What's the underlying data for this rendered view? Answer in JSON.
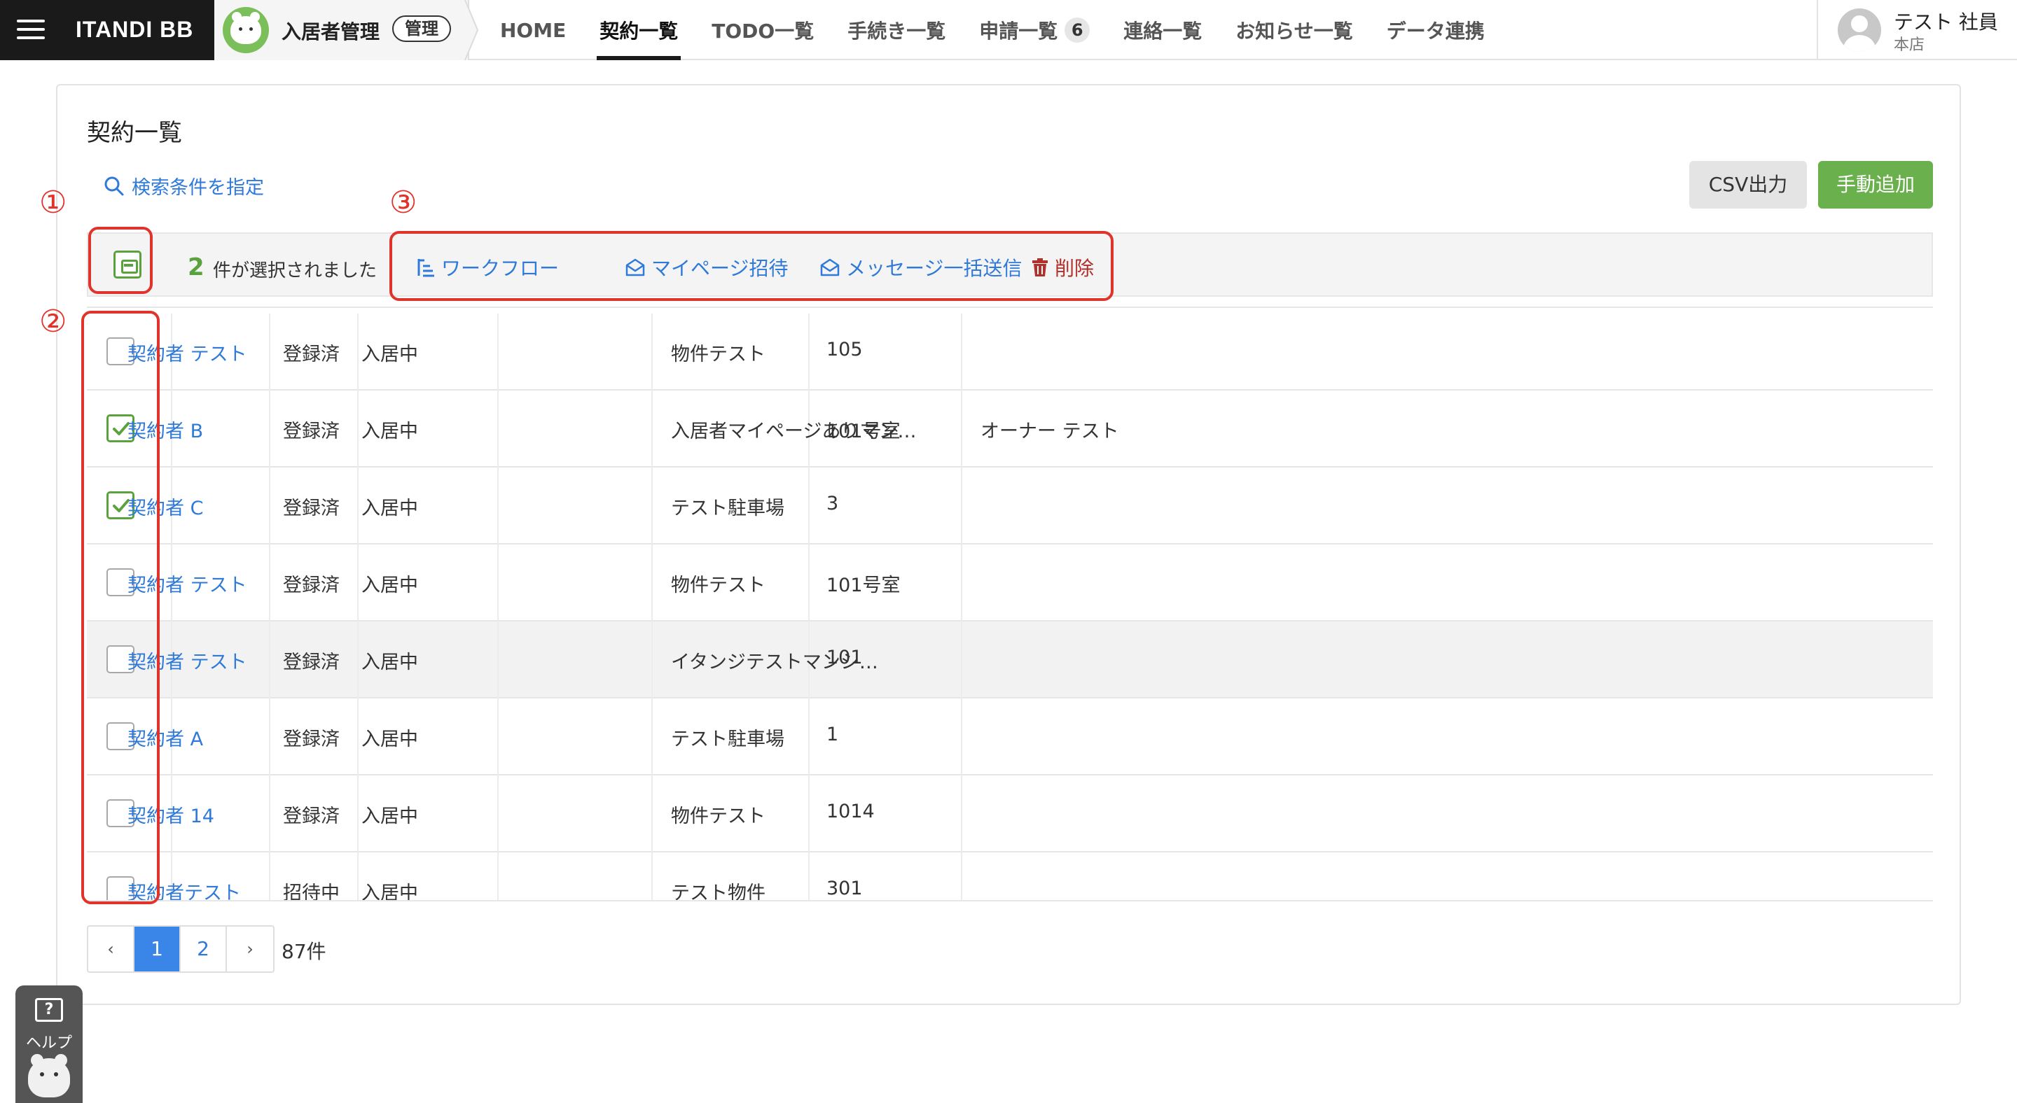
{
  "brand": {
    "name": "ITANDI BB"
  },
  "app": {
    "title": "入居者管理",
    "badge": "管理"
  },
  "nav": [
    {
      "label": "HOME",
      "count": ""
    },
    {
      "label": "契約一覧",
      "count": ""
    },
    {
      "label": "TODO一覧",
      "count": ""
    },
    {
      "label": "手続き一覧",
      "count": ""
    },
    {
      "label": "申請一覧",
      "count": "6"
    },
    {
      "label": "連絡一覧",
      "count": ""
    },
    {
      "label": "お知らせ一覧",
      "count": ""
    },
    {
      "label": "データ連携",
      "count": ""
    }
  ],
  "nav_active": "契約一覧",
  "user": {
    "name": "テスト 社員",
    "branch": "本店"
  },
  "page": {
    "title": "契約一覧",
    "search_link": "検索条件を指定",
    "csv_button": "CSV出力",
    "add_button": "手動追加"
  },
  "selection": {
    "count": "2",
    "text": "件が選択されました",
    "actions": {
      "workflow": "ワークフロー",
      "mypage_invite": "マイページ招待",
      "bulk_message": "メッセージ一括送信",
      "delete": "削除"
    }
  },
  "rows": [
    {
      "name": "契約者 テスト",
      "status": "登録済",
      "residency": "入居中",
      "property": "物件テスト",
      "room": "105",
      "owner": "",
      "checked": false
    },
    {
      "name": "契約者 B",
      "status": "登録済",
      "residency": "入居中",
      "property": "入居者マイページありマン…",
      "room": "101号室",
      "owner": "オーナー テスト",
      "checked": true
    },
    {
      "name": "契約者 C",
      "status": "登録済",
      "residency": "入居中",
      "property": "テスト駐車場",
      "room": "3",
      "owner": "",
      "checked": true
    },
    {
      "name": "契約者 テスト",
      "status": "登録済",
      "residency": "入居中",
      "property": "物件テスト",
      "room": "101号室",
      "owner": "",
      "checked": false
    },
    {
      "name": "契約者 テスト",
      "status": "登録済",
      "residency": "入居中",
      "property": "イタンジテストマンシ…",
      "room": "101",
      "owner": "",
      "checked": false
    },
    {
      "name": "契約者 A",
      "status": "登録済",
      "residency": "入居中",
      "property": "テスト駐車場",
      "room": "1",
      "owner": "",
      "checked": false
    },
    {
      "name": "契約者 14",
      "status": "登録済",
      "residency": "入居中",
      "property": "物件テスト",
      "room": "1014",
      "owner": "",
      "checked": false
    },
    {
      "name": "契約者テスト",
      "status": "招待中",
      "residency": "入居中",
      "property": "テスト物件",
      "room": "301",
      "owner": "",
      "checked": false
    }
  ],
  "pagination": {
    "prev": "‹",
    "pages": [
      "1",
      "2"
    ],
    "current": "1",
    "next": "›",
    "total": "87件"
  },
  "annotations": {
    "one": "①",
    "two": "②",
    "three": "③"
  },
  "help": {
    "label": "ヘルプ",
    "icon_text": "?"
  },
  "colors": {
    "accent_green": "#6ab04c",
    "link_blue": "#2f7ad8",
    "annotation_red": "#e0332b",
    "danger_red": "#b0302b"
  },
  "icons": {
    "menu": "hamburger-icon",
    "search": "search-icon",
    "workflow": "workflow-icon",
    "mail": "envelope-icon",
    "delete": "trash-icon",
    "avatar": "user-avatar-icon",
    "help": "help-icon"
  }
}
